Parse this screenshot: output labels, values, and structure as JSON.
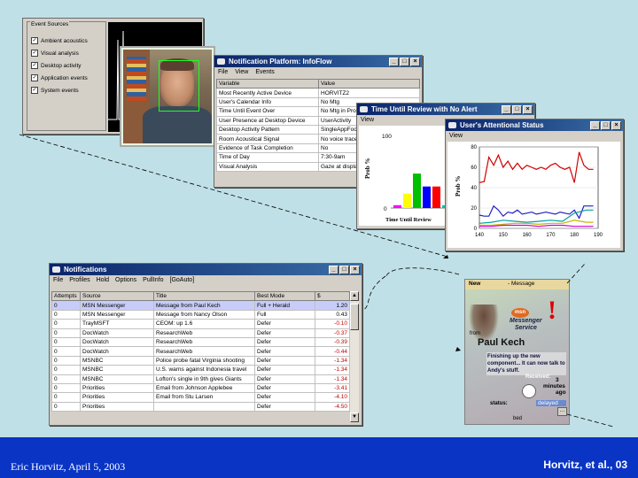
{
  "event_sources": {
    "group_label": "Event Sources",
    "items": [
      {
        "label": "Ambient acoustics",
        "checked": true
      },
      {
        "label": "Visual analysis",
        "checked": true
      },
      {
        "label": "Desktop activity",
        "checked": true
      },
      {
        "label": "Application events",
        "checked": true
      },
      {
        "label": "System events",
        "checked": true
      }
    ]
  },
  "infoflow": {
    "title": "Notification Platform: InfoFlow",
    "menu": [
      "File",
      "View",
      "Events"
    ],
    "columns": [
      "Variable",
      "Value"
    ],
    "rows": [
      [
        "Most Recently Active Device",
        "HORVITZ2"
      ],
      [
        "User's Calendar Info",
        "No Mtg"
      ],
      [
        "Time Until Event Over",
        "No Mtg in Progress"
      ],
      [
        "User Presence at Desktop Device",
        "UserActivity"
      ],
      [
        "Desktop Activity Pattern",
        "SingleAppFocus"
      ],
      [
        "Room Acoustical Signal",
        "No voice trace"
      ],
      [
        "Evidence of Task Completion",
        "No"
      ],
      [
        "Time of Day",
        "7:30-9am"
      ],
      [
        "Visual Analysis",
        "Gaze at display"
      ]
    ]
  },
  "review": {
    "title": "Time Until Review with No Alert",
    "menu": [
      "View"
    ],
    "ylabel": "Prob %",
    "xlabel": "Time Until Review",
    "ymax_label": "100",
    "zero_label": "0"
  },
  "attention": {
    "title": "User's Attentional Status",
    "menu": [
      "View"
    ],
    "ylabel": "Prob %"
  },
  "chart_data": [
    {
      "type": "bar",
      "title": "Time Until Review with No Alert",
      "ylabel": "Prob %",
      "xlabel": "Time Until Review",
      "ylim": [
        0,
        100
      ],
      "values": [
        4,
        20,
        48,
        30,
        30,
        4
      ],
      "colors": [
        "#ff00ff",
        "#ffff00",
        "#00c000",
        "#0000ff",
        "#ff0000",
        "#00c0c0"
      ]
    },
    {
      "type": "line",
      "title": "User's Attentional Status",
      "ylabel": "Prob %",
      "xlim": [
        140,
        190
      ],
      "ylim": [
        0,
        80
      ],
      "x_ticks": [
        140,
        150,
        160,
        170,
        180,
        190
      ],
      "y_ticks": [
        0,
        20,
        40,
        60,
        80
      ],
      "series": [
        {
          "color": "#d00000",
          "x": [
            140,
            142,
            144,
            146,
            148,
            150,
            152,
            154,
            156,
            158,
            160,
            162,
            164,
            166,
            168,
            170,
            172,
            174,
            176,
            178,
            180,
            182,
            184,
            186,
            188
          ],
          "y": [
            45,
            46,
            70,
            62,
            72,
            60,
            66,
            58,
            64,
            58,
            62,
            60,
            58,
            60,
            58,
            62,
            64,
            60,
            58,
            60,
            45,
            75,
            62,
            58,
            58
          ]
        },
        {
          "color": "#2020c0",
          "x": [
            140,
            142,
            144,
            146,
            148,
            150,
            152,
            154,
            156,
            158,
            160,
            162,
            164,
            166,
            168,
            170,
            172,
            174,
            176,
            178,
            180,
            182,
            184,
            186,
            188
          ],
          "y": [
            13,
            12,
            12,
            22,
            18,
            12,
            16,
            15,
            18,
            14,
            15,
            16,
            14,
            15,
            16,
            15,
            14,
            16,
            15,
            14,
            18,
            10,
            22,
            22,
            22
          ]
        },
        {
          "color": "#00a0a0",
          "x": [
            140,
            145,
            150,
            155,
            160,
            165,
            170,
            175,
            180,
            185,
            188
          ],
          "y": [
            5,
            6,
            8,
            7,
            6,
            7,
            8,
            7,
            15,
            18,
            18
          ]
        },
        {
          "color": "#c8b400",
          "x": [
            140,
            145,
            150,
            155,
            160,
            165,
            170,
            175,
            180,
            185,
            188
          ],
          "y": [
            3,
            3,
            4,
            5,
            5,
            4,
            5,
            5,
            8,
            6,
            6
          ]
        },
        {
          "color": "#d000d0",
          "x": [
            140,
            145,
            150,
            155,
            160,
            165,
            170,
            175,
            180,
            185,
            188
          ],
          "y": [
            2,
            2,
            3,
            3,
            3,
            2,
            3,
            3,
            2,
            2,
            2
          ]
        }
      ]
    }
  ],
  "notifications": {
    "title": "Notifications",
    "menu": [
      "File",
      "Profiles",
      "Hold",
      "Options",
      "PullInfo",
      "[GoAuto]"
    ],
    "columns": [
      "Attempts",
      "Source",
      "Title",
      "Best Mode",
      "$"
    ],
    "rows": [
      [
        "0",
        "MSN Messenger",
        "Message from Paul Kech",
        "Full + Herald",
        "1.20"
      ],
      [
        "0",
        "MSN Messenger",
        "Message from Nancy Olson",
        "Full",
        "0.43"
      ],
      [
        "0",
        "TrayMSFT",
        "CEOM: up 1.6",
        "Defer",
        "-0.10"
      ],
      [
        "0",
        "DocWatch",
        "ResearchWeb",
        "Defer",
        "-0.37"
      ],
      [
        "0",
        "DocWatch",
        "ResearchWeb",
        "Defer",
        "-0.39"
      ],
      [
        "0",
        "DocWatch",
        "ResearchWeb",
        "Defer",
        "-0.44"
      ],
      [
        "0",
        "MSNBC",
        "Police probe fatal Virginia shooting",
        "Defer",
        "-1.34"
      ],
      [
        "0",
        "MSNBC",
        "U.S. warns against Indonesia travel",
        "Defer",
        "-1.34"
      ],
      [
        "0",
        "MSNBC",
        "Lofton's single in 9th gives Giants",
        "Defer",
        "-1.34"
      ],
      [
        "0",
        "Priorities",
        "Email from Johnson Applebee",
        "Defer",
        "-3.41"
      ],
      [
        "0",
        "Priorities",
        "Email from Stu Larsen",
        "Defer",
        "-4.10"
      ],
      [
        "0",
        "Priorities",
        "",
        "Defer",
        "-4.50"
      ]
    ]
  },
  "messenger": {
    "tab_new": "New",
    "tab_message": "- Message",
    "brand_logo": "msn",
    "brand_line1": "Messenger",
    "brand_line2": "Service",
    "from_label": "from",
    "sender": "Paul Kech",
    "body": "Finishing up the new component... It can now talk to Andy's stuff.",
    "received_label": "Received:",
    "minutes_value": "3",
    "minutes_label": "minutes",
    "ago_label": "ago",
    "status_label": "status:",
    "status_value": "delayed",
    "bottom_label": "bed"
  },
  "footer": {
    "left": "Eric Horvitz, April 5, 2003",
    "right": "Horvitz, et al., 03"
  },
  "colors": {
    "background": "#bfe0e6",
    "footer": "#0a34c4",
    "titlebar": "#0a246a"
  }
}
